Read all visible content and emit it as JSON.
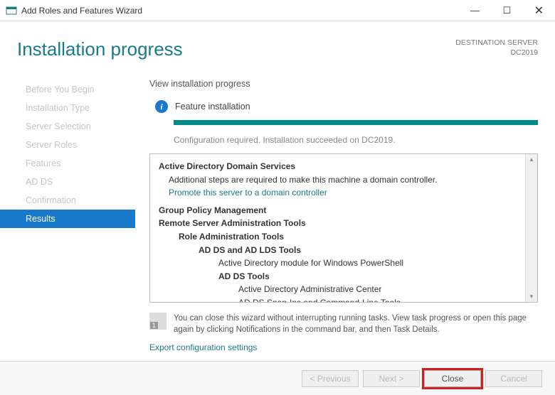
{
  "window": {
    "title": "Add Roles and Features Wizard"
  },
  "header": {
    "title": "Installation progress",
    "dest_label": "DESTINATION SERVER",
    "dest_value": "DC2019"
  },
  "sidebar": {
    "items": [
      {
        "label": "Before You Begin"
      },
      {
        "label": "Installation Type"
      },
      {
        "label": "Server Selection"
      },
      {
        "label": "Server Roles"
      },
      {
        "label": "Features"
      },
      {
        "label": "AD DS"
      },
      {
        "label": "Confirmation"
      },
      {
        "label": "Results"
      }
    ]
  },
  "main": {
    "subtitle": "View installation progress",
    "status": "Feature installation",
    "config_required": "Configuration required. Installation succeeded on DC2019."
  },
  "details": {
    "adds_title": "Active Directory Domain Services",
    "adds_msg": "Additional steps are required to make this machine a domain controller.",
    "promote_link": "Promote this server to a domain controller",
    "gpm": "Group Policy Management",
    "rsat": "Remote Server Administration Tools",
    "rat": "Role Administration Tools",
    "adlds": "AD DS and AD LDS Tools",
    "admodule": "Active Directory module for Windows PowerShell",
    "addstools": "AD DS Tools",
    "adac": "Active Directory Administrative Center",
    "snapins": "AD DS Snap-Ins and Command-Line Tools"
  },
  "hint": {
    "text": "You can close this wizard without interrupting running tasks. View task progress or open this page again by clicking Notifications in the command bar, and then Task Details."
  },
  "export_link": "Export configuration settings",
  "footer": {
    "previous": "< Previous",
    "next": "Next >",
    "close": "Close",
    "cancel": "Cancel"
  }
}
